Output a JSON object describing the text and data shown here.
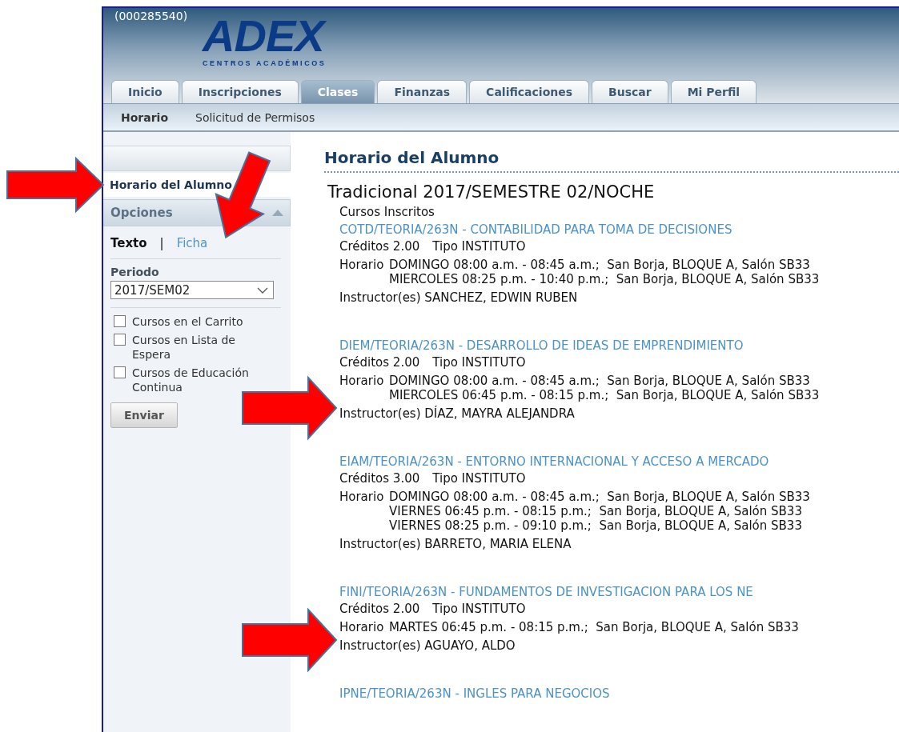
{
  "header": {
    "user_id": "(000285540)",
    "logo": {
      "name": "ADEX",
      "tagline": "CENTROS ACADÉMICOS"
    }
  },
  "tabs": [
    {
      "label": "Inicio",
      "selected": false
    },
    {
      "label": "Inscripciones",
      "selected": false
    },
    {
      "label": "Clases",
      "selected": true
    },
    {
      "label": "Finanzas",
      "selected": false
    },
    {
      "label": "Calificaciones",
      "selected": false
    },
    {
      "label": "Buscar",
      "selected": false
    },
    {
      "label": "Mi Perfil",
      "selected": false
    }
  ],
  "subnav": [
    {
      "label": "Horario",
      "selected": true
    },
    {
      "label": "Solicitud de Permisos",
      "selected": false
    }
  ],
  "sidebar": {
    "items": [
      {
        "label": "Horario del Alumno",
        "selected": true
      }
    ],
    "options": {
      "title": "Opciones",
      "expanded": true,
      "view_modes": [
        {
          "label": "Texto",
          "selected": true
        },
        {
          "label": "Ficha",
          "selected": false
        }
      ],
      "separator": "|",
      "period_label": "Periodo",
      "period_value": "2017/SEM02",
      "filters": [
        {
          "label": "Cursos en el Carrito",
          "checked": false
        },
        {
          "label": "Cursos en Lista de Espera",
          "checked": false
        },
        {
          "label": "Cursos de Educación Continua",
          "checked": false
        }
      ],
      "submit": "Enviar"
    }
  },
  "content": {
    "title": "Horario del Alumno",
    "term": "Tradicional 2017/SEMESTRE 02/NOCHE",
    "section_label": "Cursos Inscritos",
    "courses": [
      {
        "title": "COTD/TEORIA/263N - CONTABILIDAD PARA TOMA DE DECISIONES",
        "credits": "Créditos 2.00",
        "type": "Tipo INSTITUTO",
        "schedule_label": "Horario",
        "schedule": [
          "DOMINGO 08:00 a.m. - 08:45 a.m.;  San Borja, BLOQUE A, Salón SB33",
          "MIERCOLES 08:25 p.m. - 10:40 p.m.;  San Borja, BLOQUE A, Salón SB33"
        ],
        "instructor": "Instructor(es) SANCHEZ, EDWIN RUBEN"
      },
      {
        "title": "DIEM/TEORIA/263N - DESARROLLO DE IDEAS DE EMPRENDIMIENTO",
        "credits": "Créditos 2.00",
        "type": "Tipo INSTITUTO",
        "schedule_label": "Horario",
        "schedule": [
          "DOMINGO 08:00 a.m. - 08:45 a.m.;  San Borja, BLOQUE A, Salón SB33",
          "MIERCOLES 06:45 p.m. - 08:15 p.m.;  San Borja, BLOQUE A, Salón SB33"
        ],
        "instructor": "Instructor(es) DÍAZ, MAYRA ALEJANDRA"
      },
      {
        "title": "EIAM/TEORIA/263N - ENTORNO INTERNACIONAL Y ACCESO A MERCADO",
        "credits": "Créditos 3.00",
        "type": "Tipo INSTITUTO",
        "schedule_label": "Horario",
        "schedule": [
          "DOMINGO 08:00 a.m. - 08:45 a.m.;  San Borja, BLOQUE A, Salón SB33",
          "VIERNES 06:45 p.m. - 08:15 p.m.;  San Borja, BLOQUE A, Salón SB33",
          "VIERNES 08:25 p.m. - 09:10 p.m.;  San Borja, BLOQUE A, Salón SB33"
        ],
        "instructor": "Instructor(es) BARRETO, MARIA ELENA"
      },
      {
        "title": "FINI/TEORIA/263N - FUNDAMENTOS DE INVESTIGACION PARA LOS NE",
        "credits": "Créditos 2.00",
        "type": "Tipo INSTITUTO",
        "schedule_label": "Horario",
        "schedule": [
          "MARTES 06:45 p.m. - 08:15 p.m.;  San Borja, BLOQUE A, Salón SB33"
        ],
        "instructor": "Instructor(es) AGUAYO, ALDO"
      },
      {
        "title": "IPNE/TEORIA/263N - INGLES PARA NEGOCIOS"
      }
    ]
  }
}
